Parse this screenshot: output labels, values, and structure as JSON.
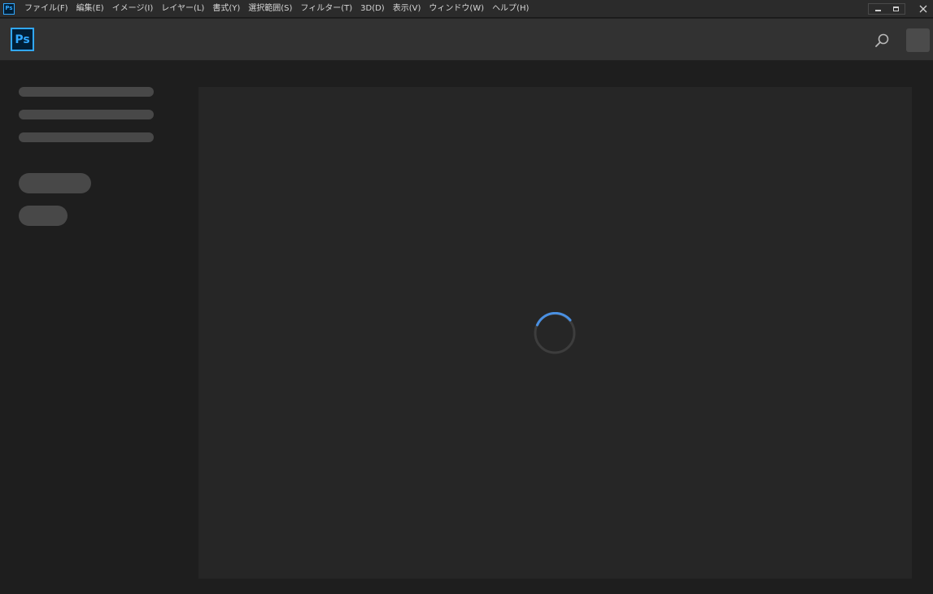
{
  "app": {
    "icon_text": "Ps",
    "brand_color": "#31a8ff",
    "brand_bg": "#001e36"
  },
  "menubar": {
    "items": [
      {
        "label": "ファイル(F)"
      },
      {
        "label": "編集(E)"
      },
      {
        "label": "イメージ(I)"
      },
      {
        "label": "レイヤー(L)"
      },
      {
        "label": "書式(Y)"
      },
      {
        "label": "選択範囲(S)"
      },
      {
        "label": "フィルター(T)"
      },
      {
        "label": "3D(D)"
      },
      {
        "label": "表示(V)"
      },
      {
        "label": "ウィンドウ(W)"
      },
      {
        "label": "ヘルプ(H)"
      }
    ]
  },
  "header": {
    "logo_text": "Ps",
    "search_icon": "search-icon"
  },
  "main": {
    "loading": true,
    "spinner_color": "#4a90e2"
  }
}
